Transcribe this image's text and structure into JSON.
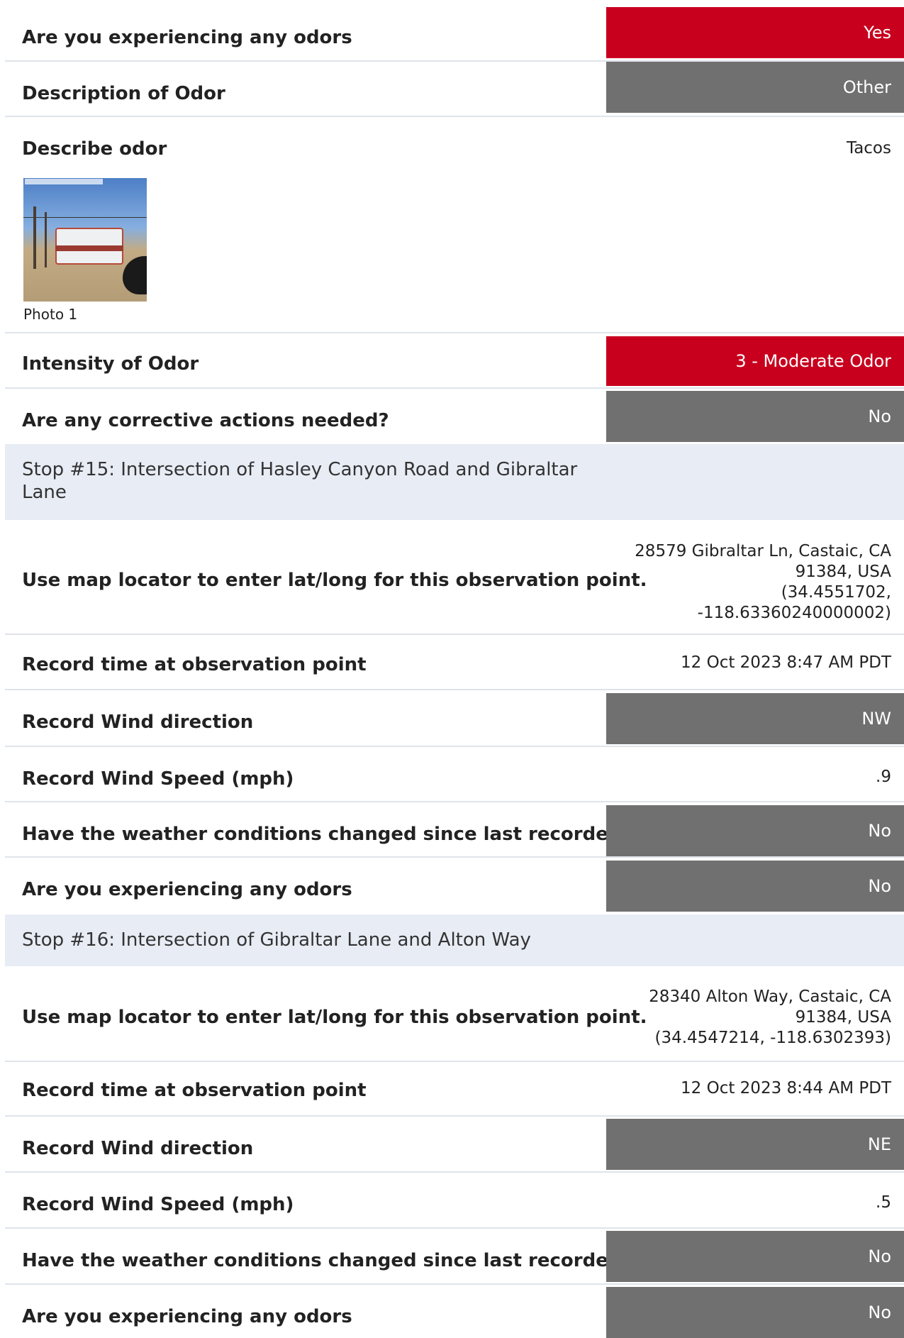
{
  "colors": {
    "red": "#c8001e",
    "grey": "#707070",
    "section_bg": "#e8ecf5"
  },
  "block_a": {
    "odors_q": "Are you experiencing any odors",
    "odors_a": "Yes",
    "desc_q": "Description of Odor",
    "desc_a": "Other",
    "describe_q": "Describe odor",
    "describe_a": "Tacos",
    "photo_caption": "Photo 1",
    "intensity_q": "Intensity of Odor",
    "intensity_a": "3 - Moderate Odor",
    "corrective_q": "Are any corrective actions needed?",
    "corrective_a": "No"
  },
  "stop15": {
    "title_line1": "Stop #15: Intersection of Hasley Canyon Road and Gibraltar",
    "title_line2": "Lane",
    "map_q": "Use map locator to enter lat/long for this observation point.",
    "map_a_line1": "28579 Gibraltar Ln, Castaic, CA",
    "map_a_line2": "91384, USA",
    "map_a_line3": "(34.4551702,",
    "map_a_line4": "-118.63360240000002)",
    "time_q": "Record time at observation point",
    "time_a": "12 Oct 2023 8:47 AM PDT",
    "winddir_q": "Record Wind direction",
    "winddir_a": "NW",
    "windspeed_q": "Record Wind Speed (mph)",
    "windspeed_a": ".9",
    "weather_q": "Have the weather conditions changed since last recorded?",
    "weather_a": "No",
    "odors_q": "Are you experiencing any odors",
    "odors_a": "No"
  },
  "stop16": {
    "title": "Stop #16: Intersection of Gibraltar Lane and Alton Way",
    "map_q": "Use map locator to enter lat/long for this observation point.",
    "map_a_line1": "28340 Alton Way, Castaic, CA",
    "map_a_line2": "91384, USA",
    "map_a_line3": "(34.4547214, -118.6302393)",
    "time_q": "Record time at observation point",
    "time_a": "12 Oct 2023 8:44 AM PDT",
    "winddir_q": "Record Wind direction",
    "winddir_a": "NE",
    "windspeed_q": "Record Wind Speed (mph)",
    "windspeed_a": ".5",
    "weather_q": "Have the weather conditions changed since last recorded?",
    "weather_a": "No",
    "odors_q": "Are you experiencing any odors",
    "odors_a": "No"
  }
}
